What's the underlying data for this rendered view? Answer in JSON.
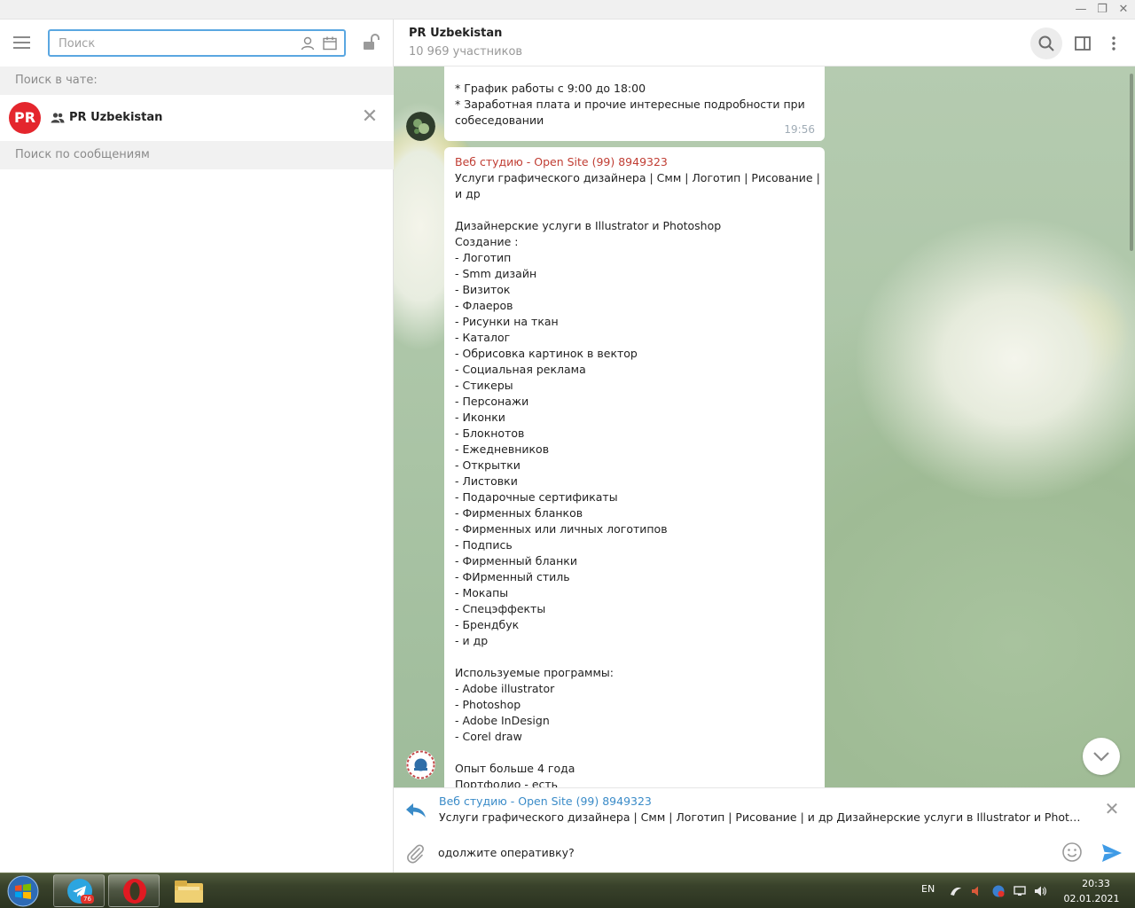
{
  "window": {
    "minimize_glyph": "—",
    "maximize_glyph": "❐",
    "close_glyph": "✕"
  },
  "sidebar": {
    "search_placeholder": "Поиск",
    "search_in_chat_label": "Поиск в чате:",
    "chat_row": {
      "avatar_text": "PR",
      "name": "PR Uzbekistan",
      "close_glyph": "✕"
    },
    "search_messages_label": "Поиск по сообщениям"
  },
  "chat": {
    "title": "PR Uzbekistan",
    "subtitle": "10 969 участников",
    "messages": [
      {
        "lines": [
          "* График работы с 9:00 до 18:00",
          "* Заработная плата и прочие интересные подробности при",
          "собеседовании"
        ],
        "time": "19:56"
      },
      {
        "sender": "Веб студию - Open Site (99) 8949323",
        "lines": [
          "Услуги графического дизайнера | Смм | Логотип | Рисование |",
          "и др",
          "",
          "Дизайнерские услуги в Illustrator и Photoshop",
          "Создание :",
          "- Логотип",
          "- Smm дизайн",
          "- Визиток",
          "- Флаеров",
          "- Рисунки на ткан",
          "- Каталог",
          "- Обрисовка картинок в вектор",
          "- Социальная реклама",
          "- Стикеры",
          "- Персонажи",
          "- Иконки",
          "- Блокнотов",
          "- Ежедневников",
          "- Открытки",
          "- Листовки",
          "- Подарочные сертификаты",
          "- Фирменных бланков",
          "- Фирменных или личных логотипов",
          "- Подпись",
          "- Фирменный бланки",
          "- ФИрменный стиль",
          "- Мокапы",
          "- Спецэффекты",
          "- Брендбук",
          "- и др",
          "",
          "Используемые программы:",
          "- Adobe illustrator",
          "- Photoshop",
          "- Adobe InDesign",
          "- Corel draw",
          "",
          "Опыт больше 4 года",
          "Портфолио - есть"
        ]
      }
    ],
    "reply": {
      "name": "Веб студию - Open Site (99) 8949323",
      "text": "Услуги графического дизайнера | Смм | Логотип | Рисование | и др  Дизайнерские услуги в Illustrator и Photosho...",
      "close_glyph": "✕"
    },
    "input_value": "одолжите оперативку?"
  },
  "taskbar": {
    "telegram_badge": "76",
    "lang": "EN",
    "time": "20:33",
    "date": "02.01.2021"
  },
  "colors": {
    "accent": "#5aa7e1",
    "sender": "#c03d33",
    "reply_name": "#3a8bc8",
    "pr_red": "#e4262d"
  }
}
